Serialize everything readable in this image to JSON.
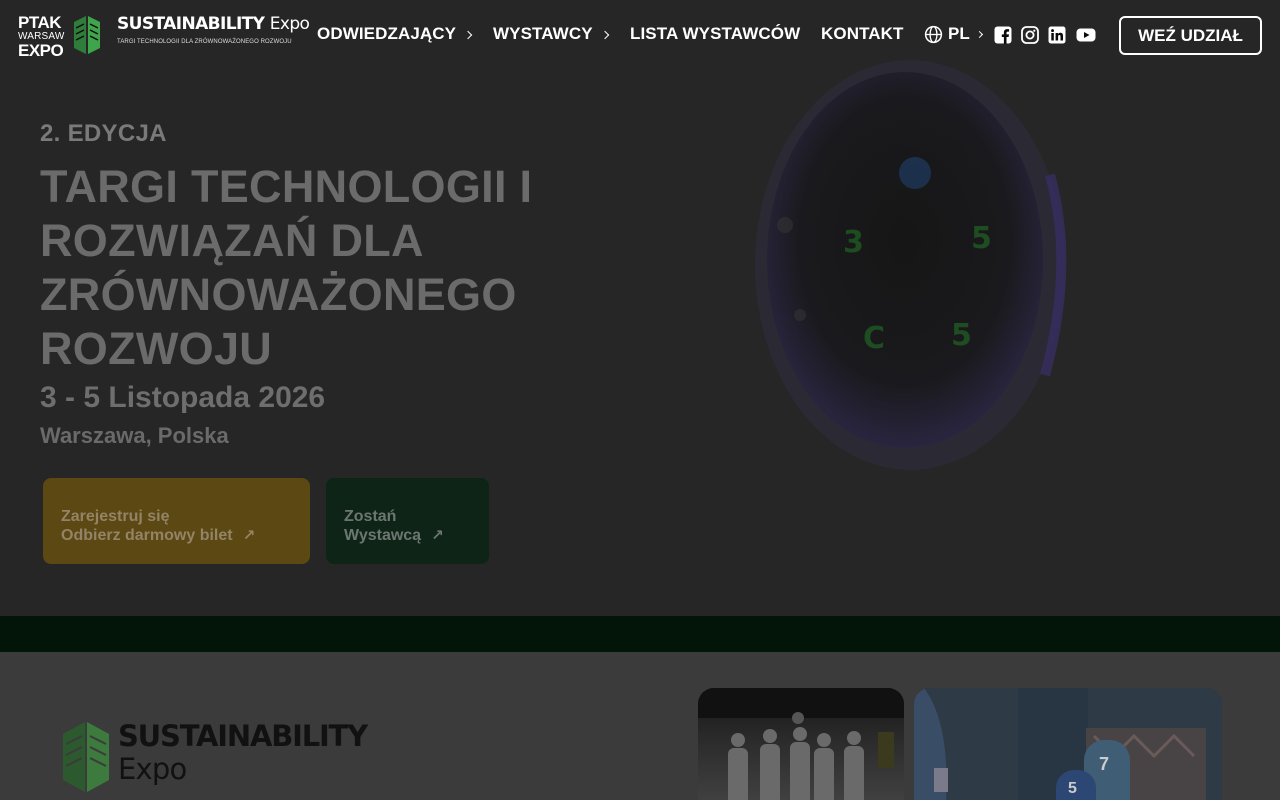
{
  "header": {
    "ptak_logo": {
      "line1": "PTAK",
      "line2": "WARSAW",
      "line3": "EXPO"
    },
    "brand_logo": {
      "name": "SUSTAINABILITY",
      "suffix": "Expo",
      "tagline": "TARGI TECHNOLOGII DLA ZRÓWNOWAŻONEGO ROZWOJU"
    },
    "nav": [
      {
        "label": "ODWIEDZAJĄCY",
        "has_submenu": true
      },
      {
        "label": "WYSTAWCY",
        "has_submenu": true
      },
      {
        "label": "LISTA WYSTAWCÓW",
        "has_submenu": false
      },
      {
        "label": "KONTAKT",
        "has_submenu": false
      }
    ],
    "language": {
      "label": "PL",
      "icon": "globe-icon"
    },
    "social": [
      "facebook-icon",
      "instagram-icon",
      "linkedin-icon",
      "youtube-icon"
    ],
    "cta_label": "WEŹ UDZIAŁ"
  },
  "hero": {
    "edition": "2. EDYCJA",
    "title": "TARGI TECHNOLOGII I ROZWIĄZAŃ DLA ZRÓWNOWAŻONEGO ROZWOJU",
    "dates": "3 - 5 Listopada 2026",
    "location": "Warszawa, Polska",
    "register_button": {
      "line1": "Zarejestruj się",
      "line2": "Odbierz darmowy bilet"
    },
    "exhibitor_button": {
      "line1": "Zostań",
      "line2": "Wystawcą"
    }
  },
  "about": {
    "brand_name": "SUSTAINABILITY",
    "brand_suffix": "Expo",
    "photo_badge_numbers": [
      "7",
      "5"
    ]
  },
  "colors": {
    "hero_overlay": "#262626",
    "register_button": "#5b4812",
    "exhibitor_button": "#0e2416",
    "green_strip": "#031509",
    "about_section": "#3b3b3b"
  }
}
